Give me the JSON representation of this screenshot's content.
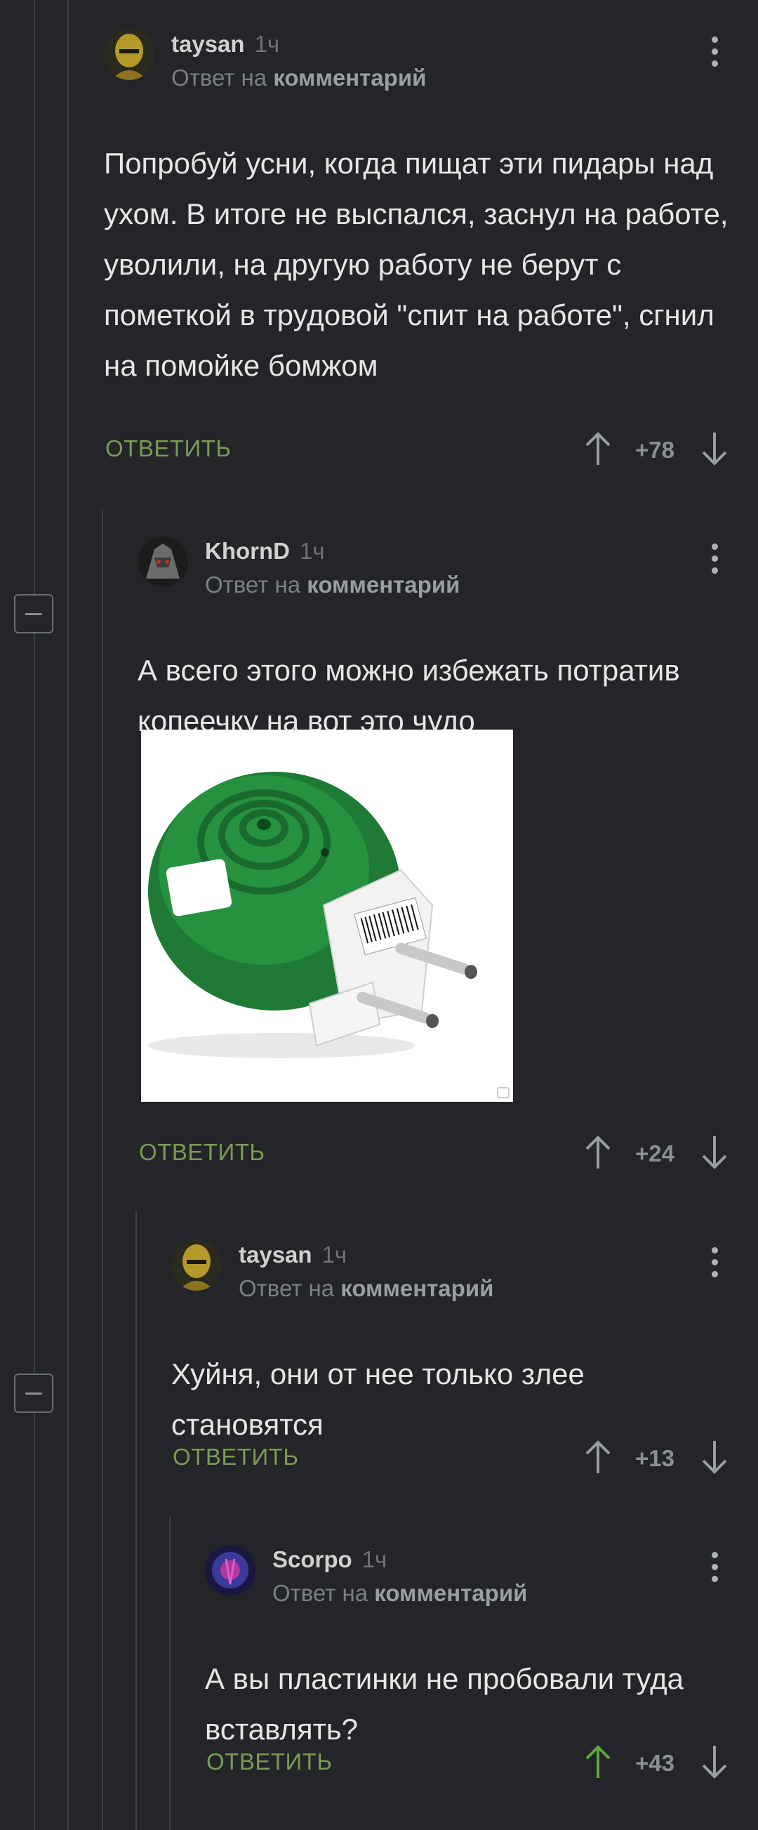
{
  "labels": {
    "reply_to": "Ответ на",
    "reply_to_bold": "комментарий",
    "reply_button": "ОТВЕТИТЬ"
  },
  "comments": [
    {
      "author": "taysan",
      "time": "1ч",
      "text": "Попробуй усни, когда пищат эти пидары над ухом. В итоге не выспался, заснул на работе, уволили, на другую работу не берут с пометкой в трудовой \"спит на работе\", сгнил на помойке бомжом",
      "rating": "+78",
      "avatar": "mask-avatar",
      "upvoted": false
    },
    {
      "author": "KhornD",
      "time": "1ч",
      "text": "А всего этого можно избежать потратив копеечку на вот это чудо",
      "rating": "+24",
      "avatar": "armor-avatar",
      "upvoted": false,
      "image": "green-mosquito-repellent-plug"
    },
    {
      "author": "taysan",
      "time": "1ч",
      "text": "Хуйня, они от нее только злее становятся",
      "rating": "+13",
      "avatar": "mask-avatar",
      "upvoted": false
    },
    {
      "author": "Scorpo",
      "time": "1ч",
      "text": "А вы пластинки не пробовали туда вставлять?",
      "rating": "+43",
      "avatar": "purple-avatar",
      "upvoted": true
    }
  ],
  "colors": {
    "background": "#232528",
    "reply": "#7a9b55",
    "upvote_active": "#5fa83b",
    "vote_idle": "#9a9ea4"
  }
}
